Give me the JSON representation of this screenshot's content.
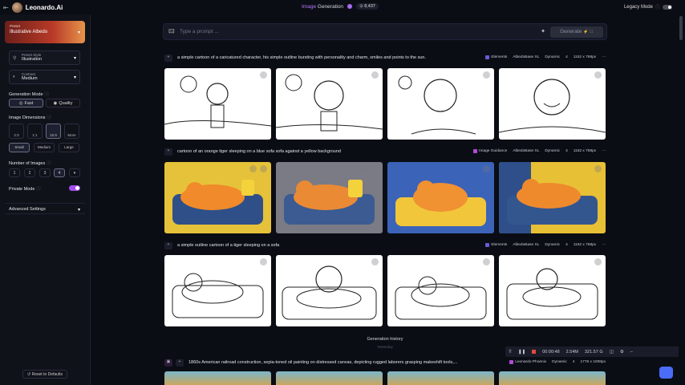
{
  "topbar": {
    "brand": "Leonardo.Ai",
    "title_prefix": "Image",
    "title_suffix": "Generation",
    "tokens": "8,437",
    "legacy_mode": "Legacy Mode"
  },
  "sidebar": {
    "preset": {
      "label": "Preset",
      "value": "Illustrative Albedo"
    },
    "preset_style": {
      "label": "Preset Style",
      "value": "Illustration"
    },
    "contrast": {
      "label": "Contrast",
      "value": "Medium"
    },
    "generation_mode": {
      "title": "Generation Mode",
      "options": [
        "Fast",
        "Quality"
      ],
      "selected": "Fast"
    },
    "image_dimensions": {
      "title": "Image Dimensions",
      "ratios": [
        "2:3",
        "1:1",
        "16:9",
        "More"
      ],
      "selected_ratio": "16:9",
      "sizes": [
        "Small",
        "Medium",
        "Large"
      ],
      "selected_size": "Small"
    },
    "number_of_images": {
      "title": "Number of Images",
      "options": [
        "1",
        "2",
        "3",
        "4"
      ],
      "selected": "4"
    },
    "private_mode": {
      "label": "Private Mode",
      "enabled": true
    },
    "advanced_settings": "Advanced Settings",
    "reset": "Reset to Defaults"
  },
  "prompt": {
    "placeholder": "Type a prompt ...",
    "generate_label": "Generate",
    "generate_cost": "⚡ 11"
  },
  "generations": [
    {
      "prompt": "a simple cartoon of a caricatured character, his simple outline bursting with personality and charm, smiles and points to the sun.",
      "tags": [
        "Elements",
        "AlbedoBase XL",
        "Dynamic",
        "4",
        "1152 x 768px"
      ],
      "style": "lineart-sunflower"
    },
    {
      "prompt": "cartoon of an orange tiger sleeping on a blue sofa sofa against a yellow background",
      "tags": [
        "Image Guidance",
        "AlbedoBase XL",
        "Dynamic",
        "4",
        "1152 x 768px"
      ],
      "style": "color-tiger"
    },
    {
      "prompt": "a simple outline cartoon of a tiger sleeping on a sofa",
      "tags": [
        "Elements",
        "AlbedoBase XL",
        "Dynamic",
        "4",
        "1152 x 768px"
      ],
      "style": "lineart-tiger"
    },
    {
      "prompt": "1860s American railroad construction, sepia-toned oil painting on distressed canvas, depicting rugged laborers grasping makeshift tools,...",
      "tags": [
        "Leonardo Phoenix",
        "Dynamic",
        "4",
        "1776 x 1008px"
      ],
      "style": "painting"
    }
  ],
  "history": {
    "title": "Generation history",
    "sub": "Yesterday"
  },
  "recorder": {
    "time": "00:00:48",
    "size": "2.54M",
    "free": "321.57 G"
  },
  "colors": {
    "accent": "#a24df0",
    "preset_start": "#6e1f1a",
    "preset_end": "#e7944a",
    "bg": "#0b0d14"
  }
}
